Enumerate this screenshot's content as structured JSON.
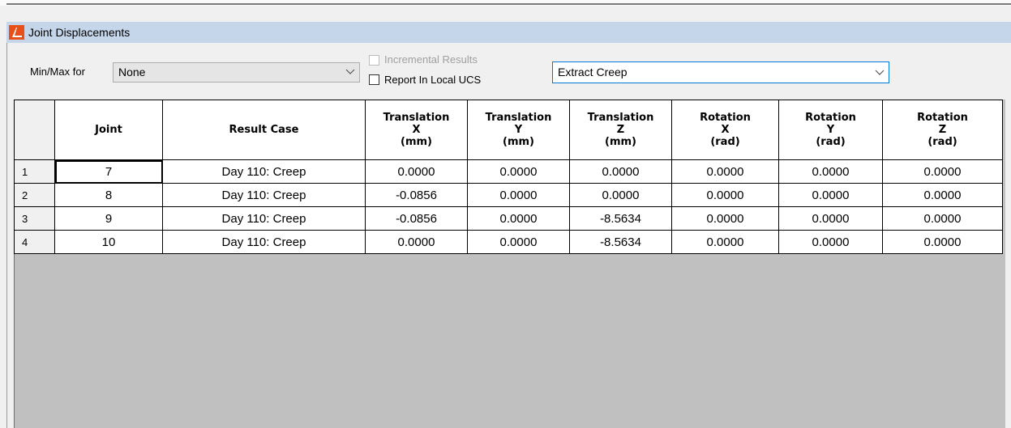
{
  "window": {
    "title": "Joint Displacements"
  },
  "toolbar": {
    "minmax_label": "Min/Max for",
    "minmax_value": "None",
    "incremental_label": "Incremental Results",
    "incremental_checked": false,
    "incremental_enabled": false,
    "local_ucs_label": "Report In Local UCS",
    "local_ucs_checked": false,
    "extract_value": "Extract Creep"
  },
  "icons": {
    "app": "app-logo-icon",
    "dropdown": "chevron-down-icon"
  },
  "colors": {
    "titlebar": "#c6d6ea",
    "grid_background": "#c0c0c0",
    "combo_focus": "#0078d7",
    "app_icon": "#e8501a"
  },
  "table": {
    "headers": [
      [
        "Joint"
      ],
      [
        "Result Case"
      ],
      [
        "Translation",
        "X",
        "(mm)"
      ],
      [
        "Translation",
        "Y",
        "(mm)"
      ],
      [
        "Translation",
        "Z",
        "(mm)"
      ],
      [
        "Rotation",
        "X",
        "(rad)"
      ],
      [
        "Rotation",
        "Y",
        "(rad)"
      ],
      [
        "Rotation",
        "Z",
        "(rad)"
      ]
    ],
    "rows": [
      {
        "num": "1",
        "joint": "7",
        "case": "Day 110: Creep",
        "tx": "0.0000",
        "ty": "0.0000",
        "tz": "0.0000",
        "rx": "0.0000",
        "ry": "0.0000",
        "rz": "0.0000"
      },
      {
        "num": "2",
        "joint": "8",
        "case": "Day 110: Creep",
        "tx": "-0.0856",
        "ty": "0.0000",
        "tz": "0.0000",
        "rx": "0.0000",
        "ry": "0.0000",
        "rz": "0.0000"
      },
      {
        "num": "3",
        "joint": "9",
        "case": "Day 110: Creep",
        "tx": "-0.0856",
        "ty": "0.0000",
        "tz": "-8.5634",
        "rx": "0.0000",
        "ry": "0.0000",
        "rz": "0.0000"
      },
      {
        "num": "4",
        "joint": "10",
        "case": "Day 110: Creep",
        "tx": "0.0000",
        "ty": "0.0000",
        "tz": "-8.5634",
        "rx": "0.0000",
        "ry": "0.0000",
        "rz": "0.0000"
      }
    ]
  }
}
